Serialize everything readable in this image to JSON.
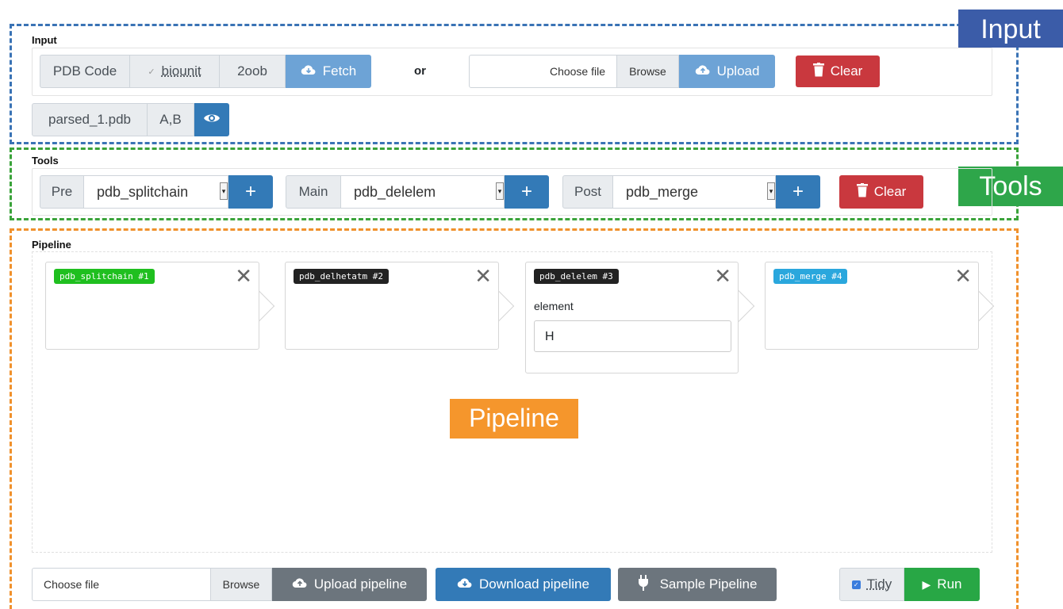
{
  "labels": {
    "input_overlay": "Input",
    "tools_overlay": "Tools",
    "pipeline_overlay": "Pipeline"
  },
  "input": {
    "title": "Input",
    "pdb_code_label": "PDB Code",
    "biounit_label": "biounit",
    "pdb_code_value": "2oob",
    "fetch_label": "Fetch",
    "or_label": "or",
    "choose_file": "Choose file",
    "browse": "Browse",
    "upload_label": "Upload",
    "clear_label": "Clear",
    "parsed_file": "parsed_1.pdb",
    "chains": "A,B"
  },
  "tools": {
    "title": "Tools",
    "pre_label": "Pre",
    "pre_value": "pdb_splitchain",
    "main_label": "Main",
    "main_value": "pdb_delelem",
    "post_label": "Post",
    "post_value": "pdb_merge",
    "add_symbol": "+",
    "clear_label": "Clear"
  },
  "pipeline": {
    "title": "Pipeline",
    "steps": [
      {
        "name": "pdb_splitchain #1",
        "color": "#1fbf1f"
      },
      {
        "name": "pdb_delhetatm #2",
        "color": "#222222"
      },
      {
        "name": "pdb_delelem #3",
        "color": "#222222",
        "param_label": "element",
        "param_value": "H"
      },
      {
        "name": "pdb_merge #4",
        "color": "#2aa7dd"
      }
    ],
    "close_symbol": "✕"
  },
  "footer": {
    "choose_file": "Choose file",
    "browse": "Browse",
    "upload_pipeline": "Upload pipeline",
    "download_pipeline": "Download pipeline",
    "sample_pipeline": "Sample Pipeline",
    "tidy_label": "Tidy",
    "run_label": "Run"
  },
  "colors": {
    "input_border": "#3a73b5",
    "tools_border": "#3aa33a",
    "pipeline_border": "#f0912c"
  }
}
